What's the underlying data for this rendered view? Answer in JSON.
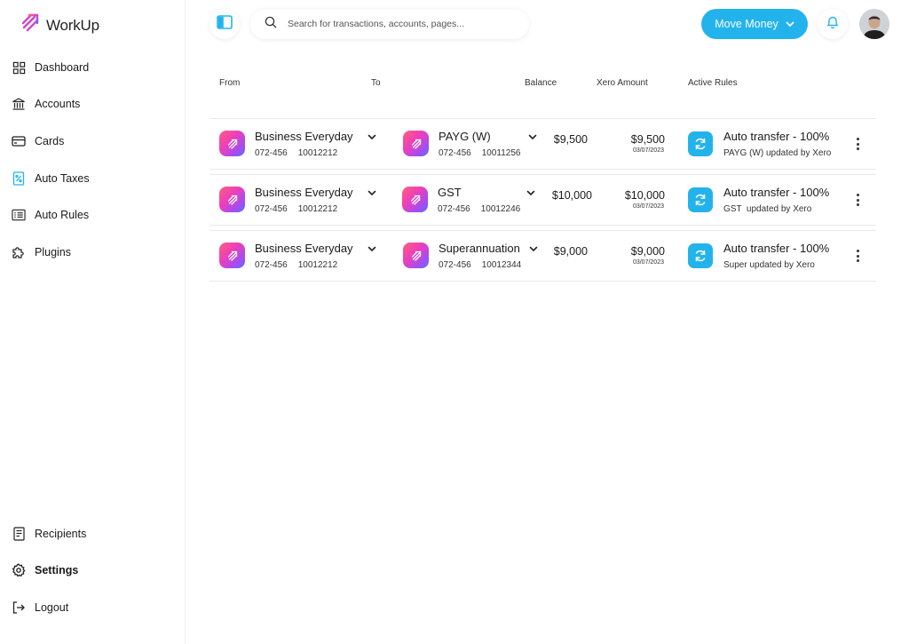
{
  "app": {
    "name": "WorkUp"
  },
  "sidebar": {
    "items": [
      {
        "label": "Dashboard",
        "icon": "grid-icon"
      },
      {
        "label": "Accounts",
        "icon": "bank-icon"
      },
      {
        "label": "Cards",
        "icon": "card-icon"
      },
      {
        "label": "Auto Taxes",
        "icon": "tax-icon",
        "accent": "#23b3ec"
      },
      {
        "label": "Auto Rules",
        "icon": "rules-list-icon"
      },
      {
        "label": "Plugins",
        "icon": "puzzle-icon"
      }
    ],
    "bottom": [
      {
        "label": "Recipients",
        "icon": "document-icon"
      },
      {
        "label": "Settings",
        "icon": "gear-icon",
        "active": true
      },
      {
        "label": "Logout",
        "icon": "logout-icon"
      }
    ]
  },
  "header": {
    "search_placeholder": "Search for transactions, accounts, pages...",
    "move_money_label": "Move Money",
    "accent": "#23b3ec"
  },
  "table": {
    "columns": {
      "from": "From",
      "to": "To",
      "balance": "Balance",
      "xero": "Xero Amount",
      "rules": "Active Rules"
    },
    "rows": [
      {
        "from": {
          "name": "Business Everyday",
          "bsb": "072-456",
          "account": "10012212"
        },
        "to": {
          "name": "PAYG (W)",
          "bsb": "072-456",
          "account": "10011256"
        },
        "balance": "$9,500",
        "xero_amount": "$9,500",
        "xero_date": "03/07/2023",
        "rule_title": "Auto transfer - 100%",
        "rule_sub": "PAYG (W) updated by Xero"
      },
      {
        "from": {
          "name": "Business Everyday",
          "bsb": "072-456",
          "account": "10012212"
        },
        "to": {
          "name": "GST",
          "bsb": "072-456",
          "account": "10012246"
        },
        "balance": "$10,000",
        "xero_amount": "$10,000",
        "xero_date": "03/07/2023",
        "rule_title": "Auto transfer - 100%",
        "rule_sub": "GST  updated by Xero"
      },
      {
        "from": {
          "name": "Business Everyday",
          "bsb": "072-456",
          "account": "10012212"
        },
        "to": {
          "name": "Superannuation",
          "bsb": "072-456",
          "account": "10012344"
        },
        "balance": "$9,000",
        "xero_amount": "$9,000",
        "xero_date": "03/07/2023",
        "rule_title": "Auto transfer - 100%",
        "rule_sub": "Super updated by Xero"
      }
    ]
  }
}
